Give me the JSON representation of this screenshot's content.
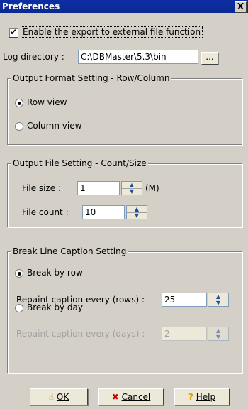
{
  "window": {
    "title": "Preferences",
    "close_glyph": "X"
  },
  "enable_export": {
    "label": "Enable the export to external file function",
    "checked": true
  },
  "log_directory": {
    "label": "Log directory :",
    "value": "C:\\DBMaster\\5.3\\bin",
    "browse_label": "..."
  },
  "output_format": {
    "title": "Output Format Setting - Row/Column",
    "options": [
      {
        "label": "Row view",
        "selected": true
      },
      {
        "label": "Column view",
        "selected": false
      }
    ]
  },
  "output_file": {
    "title": "Output File Setting - Count/Size",
    "size_label": "File size :",
    "size_value": "1",
    "size_unit": "(M)",
    "count_label": "File count :",
    "count_value": "10"
  },
  "break_line": {
    "title": "Break Line Caption Setting",
    "by_row_label": "Break by row",
    "by_row_selected": true,
    "rows_label": "Repaint caption every (rows) :",
    "rows_value": "25",
    "by_day_label": "Break by day",
    "by_day_selected": false,
    "days_label": "Repaint caption every (days) :",
    "days_value": "2"
  },
  "buttons": {
    "ok": {
      "label": "OK",
      "icon": "hand-icon"
    },
    "cancel": {
      "label": "Cancel",
      "icon": "red-x-icon"
    },
    "help": {
      "label": "Help",
      "icon": "question-icon"
    }
  }
}
